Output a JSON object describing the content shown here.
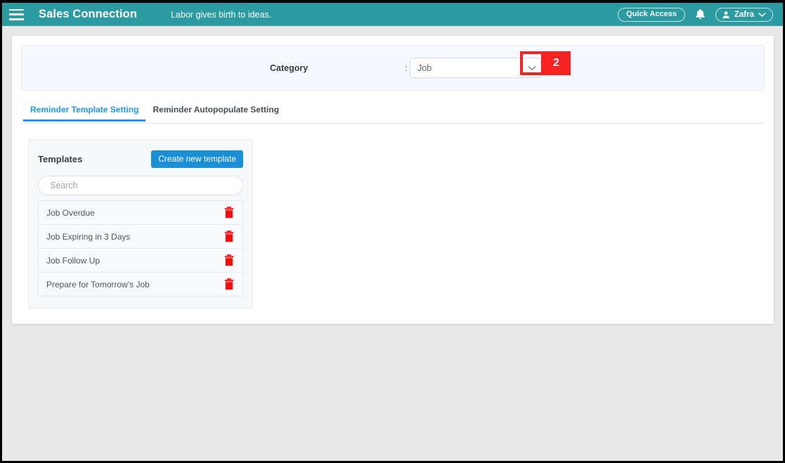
{
  "topbar": {
    "menu_icon": "hamburger-menu-icon",
    "brand": "Sales Connection",
    "tagline": "Labor gives birth to ideas.",
    "quick_access_label": "Quick Access",
    "notification_icon": "bell-icon",
    "user_icon": "user-avatar-icon",
    "user_name": "Zafra",
    "user_caret_icon": "chevron-down-icon",
    "background_color": "#2b9aa1"
  },
  "category": {
    "label": "Category",
    "separator": ":",
    "selected_value": "Job",
    "dropdown_icon": "chevron-down-icon",
    "options": [
      "Job"
    ]
  },
  "annotation": {
    "number": "2",
    "color": "#f72222"
  },
  "tabs": [
    {
      "label": "Reminder Template Setting",
      "active": true
    },
    {
      "label": "Reminder Autopopulate Setting",
      "active": false
    }
  ],
  "templates_panel": {
    "title": "Templates",
    "create_button_label": "Create new template",
    "create_button_color": "#1a8fd4",
    "search": {
      "value": "",
      "placeholder": "Search"
    },
    "delete_icon": "trash-icon",
    "items": [
      {
        "name": "Job Overdue"
      },
      {
        "name": "Job Expiring in 3 Days"
      },
      {
        "name": "Job Follow Up"
      },
      {
        "name": "Prepare for Tomorrow's Job"
      }
    ]
  }
}
